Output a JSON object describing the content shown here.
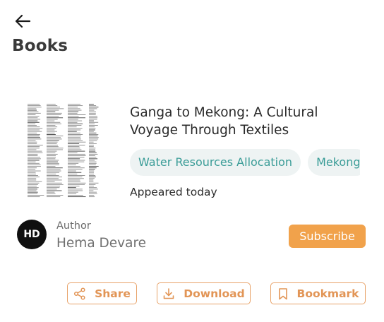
{
  "header": {
    "title": "Books"
  },
  "book": {
    "title": "Ganga to Mekong: A Cultural Voyage Through Textiles",
    "tags": [
      "Water Resources Allocation",
      "Mekong"
    ],
    "appeared": "Appeared today"
  },
  "author": {
    "initials": "HD",
    "caption": "Author",
    "name": "Hema Devare"
  },
  "subscribe_label": "Subscribe",
  "actions": {
    "share": "Share",
    "download": "Download",
    "bookmark": "Bookmark"
  },
  "colors": {
    "accent": "#f1a24b",
    "action_text": "#e29556",
    "tag_bg": "#eef3f3",
    "tag_text": "#3a9c97",
    "avatar_bg": "#101010"
  },
  "icons": {
    "back": "arrow-left-icon",
    "share": "share-icon",
    "download": "download-icon",
    "bookmark": "bookmark-icon"
  }
}
